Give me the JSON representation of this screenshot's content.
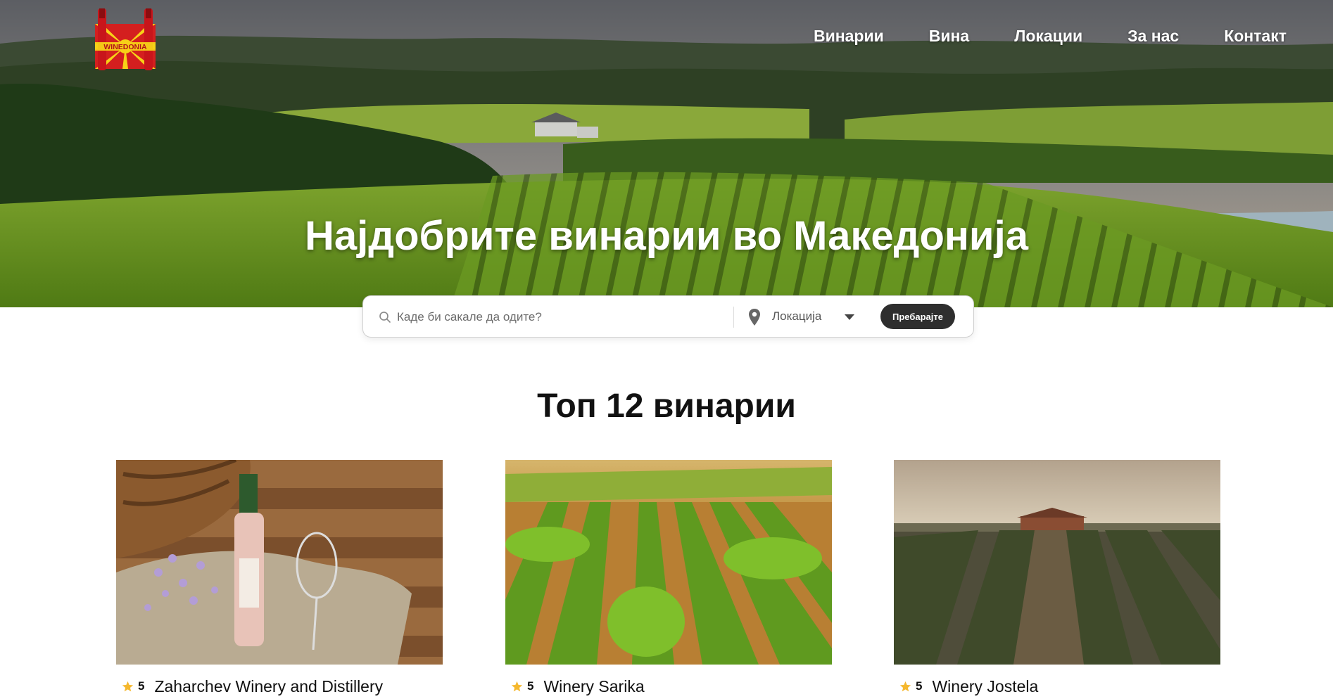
{
  "header": {
    "logo_text": "WINEDONIA",
    "nav": [
      "Винарии",
      "Вина",
      "Локации",
      "За нас",
      "Контакт"
    ]
  },
  "hero": {
    "title": "Најдобрите винарии во Македонија"
  },
  "search": {
    "placeholder": "Каде би сакале да одите?",
    "location_label": "Локација",
    "button_label": "Пребарајте"
  },
  "section": {
    "title": "Топ 12 винарии"
  },
  "wineries": [
    {
      "rating": "5",
      "name": "Zaharchev Winery and Distillery"
    },
    {
      "rating": "5",
      "name": "Winery Sarika"
    },
    {
      "rating": "5",
      "name": "Winery Jostela"
    }
  ],
  "colors": {
    "accent_dark": "#2e2e2e",
    "star": "#f5b82e",
    "logo_red": "#d41f1f",
    "logo_yellow": "#f7d117"
  }
}
